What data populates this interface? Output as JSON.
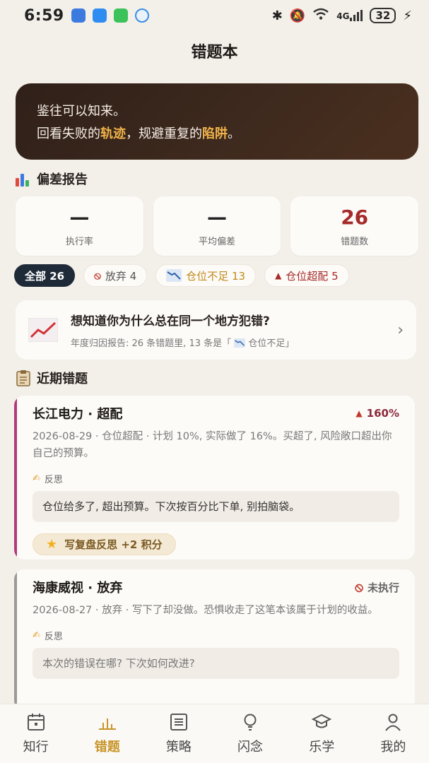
{
  "status": {
    "time": "6:59",
    "network": "4G",
    "battery": "32"
  },
  "header": {
    "title": "错题本"
  },
  "hero": {
    "line1": "鉴往可以知来。",
    "line2_pre": "回看失败的",
    "line2_hl1": "轨迹",
    "line2_mid": "，规避重复的",
    "line2_hl2": "陷阱",
    "line2_end": "。"
  },
  "report": {
    "section_title": "偏差报告",
    "stats": [
      {
        "value": "—",
        "label": "执行率"
      },
      {
        "value": "—",
        "label": "平均偏差"
      },
      {
        "value": "26",
        "label": "错题数"
      }
    ]
  },
  "filters": [
    {
      "label": "全部 26"
    },
    {
      "label": "放弃 4"
    },
    {
      "label": "仓位不足 13"
    },
    {
      "label": "仓位超配 5"
    }
  ],
  "insight": {
    "title": "想知道你为什么总在同一个地方犯错?",
    "subtitle_pre": "年度归因报告: 26 条错题里, 13 条是「",
    "subtitle_tag": "仓位不足」"
  },
  "recent": {
    "section_title": "近期错题",
    "reflect_label": "反思",
    "items": [
      {
        "title": "长江电力 · 超配",
        "badge": "160%",
        "desc": "2026-08-29 · 仓位超配 · 计划 10%, 实际做了 16%。买超了, 风险敞口超出你自己的预算。",
        "reflection": "仓位给多了, 超出预算。下次按百分比下单, 别拍脑袋。",
        "reward": "写复盘反思  +2 积分"
      },
      {
        "title": "海康威视 · 放弃",
        "badge": "未执行",
        "desc": "2026-08-27 · 放弃 · 写下了却没做。恐惧收走了这笔本该属于计划的收益。",
        "reflection_placeholder": "本次的错误在哪? 下次如何改进?"
      }
    ]
  },
  "nav": [
    {
      "label": "知行",
      "icon": "calendar-icon"
    },
    {
      "label": "错题",
      "icon": "bar-chart-icon"
    },
    {
      "label": "策略",
      "icon": "list-icon"
    },
    {
      "label": "闪念",
      "icon": "lightbulb-icon"
    },
    {
      "label": "乐学",
      "icon": "graduation-cap-icon"
    },
    {
      "label": "我的",
      "icon": "user-icon"
    }
  ],
  "colors": {
    "accent_gold": "#c8952a",
    "hero_bg": "#3f2a1e",
    "danger": "#a52a2a",
    "active_chip": "#1f2a38"
  }
}
